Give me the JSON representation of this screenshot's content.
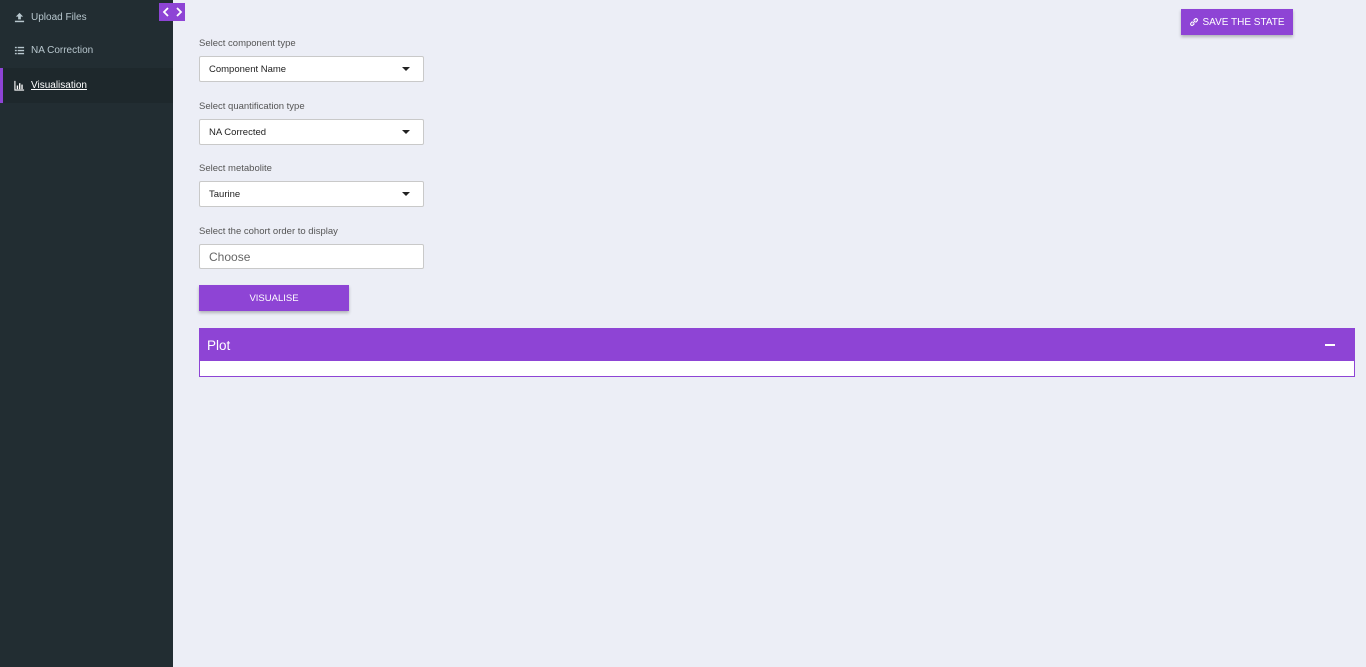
{
  "sidebar": {
    "items": [
      {
        "label": "Upload Files",
        "icon": "upload-icon"
      },
      {
        "label": "NA Correction",
        "icon": "list-icon"
      },
      {
        "label": "Visualisation",
        "icon": "bar-chart-icon",
        "active": true
      }
    ]
  },
  "header": {
    "save_label": "SAVE THE STATE"
  },
  "form": {
    "component_type": {
      "label": "Select component type",
      "value": "Component Name"
    },
    "quantification_type": {
      "label": "Select quantification type",
      "value": "NA Corrected"
    },
    "metabolite": {
      "label": "Select metabolite",
      "value": "Taurine"
    },
    "cohort_order": {
      "label": "Select the cohort order to display",
      "placeholder": "Choose"
    },
    "visualise_label": "VISUALISE"
  },
  "plot": {
    "title": "Plot"
  },
  "colors": {
    "accent": "#8e44d5",
    "sidebar_bg": "#222d32",
    "page_bg": "#eceef6"
  }
}
